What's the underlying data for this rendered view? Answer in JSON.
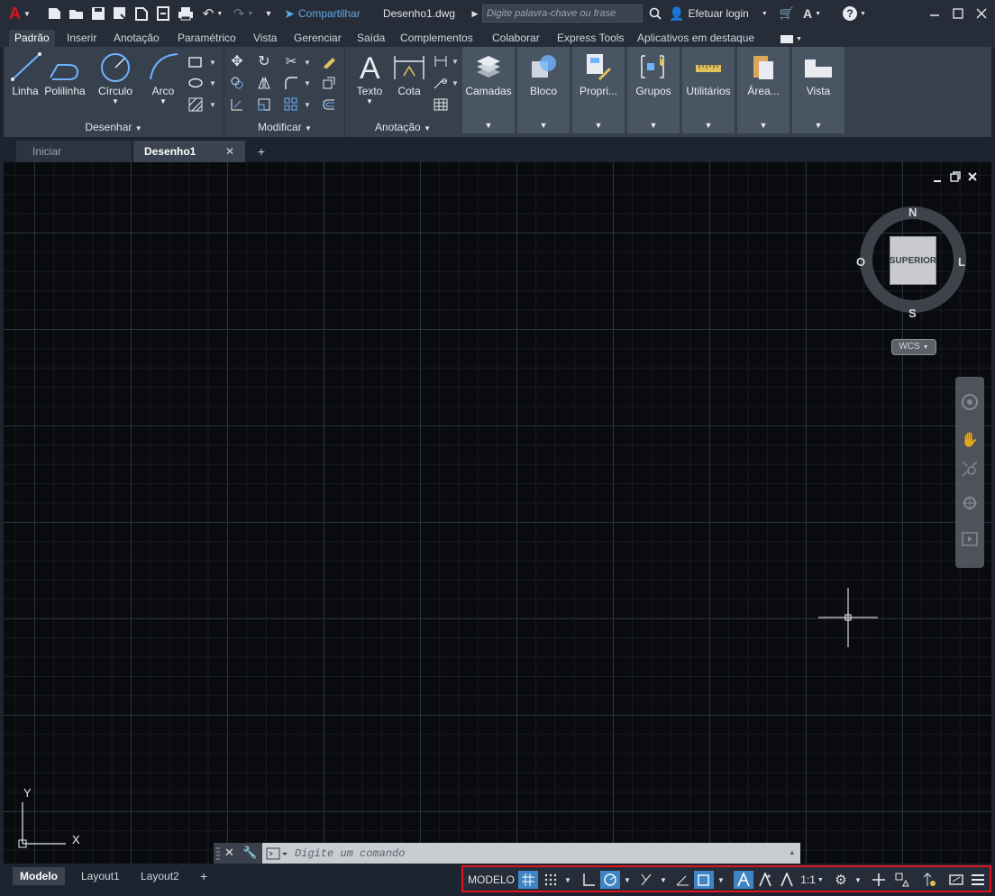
{
  "titlebar": {
    "share_label": "Compartilhar",
    "document_name": "Desenho1.dwg",
    "search_placeholder": "Digite palavra-chave ou frase",
    "login_label": "Efetuar login"
  },
  "ribbon_tabs": [
    "Padrão",
    "Inserir",
    "Anotação",
    "Paramétrico",
    "Vista",
    "Gerenciar",
    "Saída",
    "Complementos",
    "Colaborar",
    "Express Tools",
    "Aplicativos em destaque"
  ],
  "ribbon": {
    "desenhar": {
      "title": "Desenhar",
      "tools": [
        "Linha",
        "Polilinha",
        "Círculo",
        "Arco"
      ]
    },
    "modificar": {
      "title": "Modificar"
    },
    "anotacao": {
      "title": "Anotação",
      "tools": [
        "Texto",
        "Cota"
      ]
    },
    "groups": [
      "Camadas",
      "Bloco",
      "Propri...",
      "Grupos",
      "Utilitários",
      "Área...",
      "Vista"
    ]
  },
  "doc_tabs": {
    "start": "Iniciar",
    "current": "Desenho1"
  },
  "viewcube": {
    "north": "N",
    "south": "S",
    "east": "L",
    "west": "O",
    "face": "SUPERIOR",
    "wcs": "WCS"
  },
  "ucs": {
    "x": "X",
    "y": "Y"
  },
  "command_line": {
    "placeholder": "Digite um comando"
  },
  "layout_tabs": [
    "Modelo",
    "Layout1",
    "Layout2"
  ],
  "status_bar": {
    "model_label": "MODELO",
    "scale": "1:1"
  },
  "colors": {
    "accent": "#3f84c4",
    "highlight_border": "#e0141e",
    "canvas": "#0a0b0e"
  }
}
